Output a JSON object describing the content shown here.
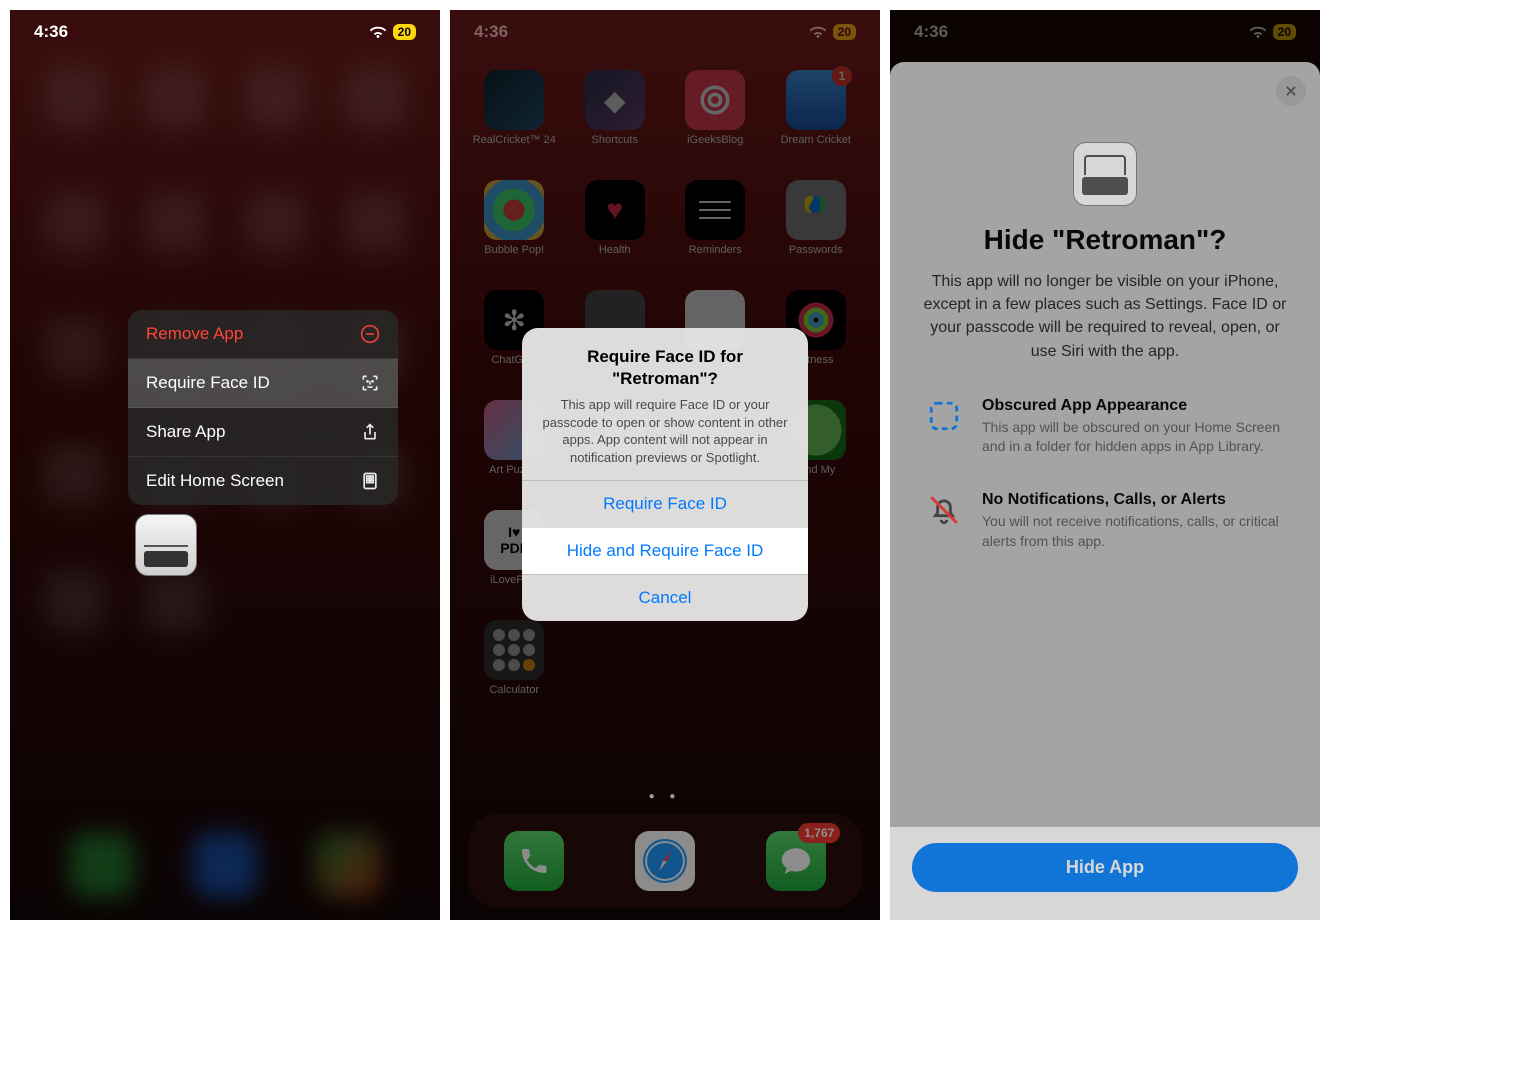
{
  "status": {
    "time": "4:36",
    "battery": "20"
  },
  "screen1": {
    "menu": {
      "remove": "Remove App",
      "faceid": "Require Face ID",
      "share": "Share App",
      "edit": "Edit Home Screen"
    }
  },
  "screen2": {
    "apps_row1": [
      {
        "name": "RealCricket™ 24"
      },
      {
        "name": "Shortcuts"
      },
      {
        "name": "iGeeksBlog"
      },
      {
        "name": "Dream Cricket",
        "badge": "1"
      }
    ],
    "apps_row2": [
      {
        "name": "Bubble Pop!"
      },
      {
        "name": "Health"
      },
      {
        "name": "Reminders"
      },
      {
        "name": "Passwords"
      }
    ],
    "apps_row3": [
      {
        "name": "ChatGPT"
      },
      {
        "name": ""
      },
      {
        "name": ""
      },
      {
        "name": "Fitness"
      }
    ],
    "apps_row4": [
      {
        "name": "Art Puzzle"
      },
      {
        "name": ""
      },
      {
        "name": ""
      },
      {
        "name": "Find My"
      }
    ],
    "apps_row5": [
      {
        "name": "iLovePDF"
      },
      {
        "name": ""
      },
      {
        "name": ""
      },
      {
        "name": ""
      }
    ],
    "apps_row6": [
      {
        "name": "Calculator"
      }
    ],
    "dock_badge": "1,767",
    "alert": {
      "title": "Require Face ID for \"Retroman\"?",
      "body": "This app will require Face ID or your passcode to open or show content in other apps. App content will not appear in notification previews or Spotlight.",
      "btn1": "Require Face ID",
      "btn2": "Hide and Require Face ID",
      "btn3": "Cancel"
    }
  },
  "screen3": {
    "title": "Hide \"Retroman\"?",
    "lead": "This app will no longer be visible on your iPhone, except in a few places such as Settings. Face ID or your passcode will be required to reveal, open, or use Siri with the app.",
    "feat1_title": "Obscured App Appearance",
    "feat1_body": "This app will be obscured on your Home Screen and in a folder for hidden apps in App Library.",
    "feat2_title": "No Notifications, Calls, or Alerts",
    "feat2_body": "You will not receive notifications, calls, or critical alerts from this app.",
    "hide_btn": "Hide App"
  }
}
